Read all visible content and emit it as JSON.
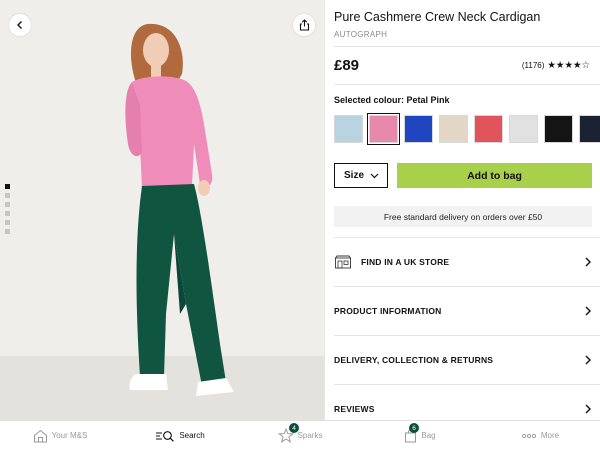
{
  "product": {
    "title": "Pure Cashmere Crew Neck Cardigan",
    "brand": "AUTOGRAPH",
    "price": "£89",
    "review_count": "(1176)",
    "rating": 4,
    "stars_display": "★★★★☆",
    "selected_colour_label": "Selected colour: Petal Pink",
    "swatches": [
      {
        "name": "Light Blue",
        "color": "#b9d3e0"
      },
      {
        "name": "Petal Pink",
        "color": "#e789ad",
        "selected": true
      },
      {
        "name": "Bright Blue",
        "color": "#1f45c0"
      },
      {
        "name": "Oatmeal",
        "color": "#e2d7c4"
      },
      {
        "name": "Coral Red",
        "color": "#e2545c"
      },
      {
        "name": "Light Grey",
        "color": "#e1e1e1"
      },
      {
        "name": "Black",
        "color": "#141414"
      },
      {
        "name": "Navy",
        "color": "#1b2333"
      }
    ],
    "size_label": "Size",
    "add_to_bag_label": "Add to bag",
    "delivery_text": "Free standard delivery on orders over £50",
    "rows": [
      {
        "label": "FIND IN A UK STORE",
        "icon": "store-icon"
      },
      {
        "label": "PRODUCT INFORMATION"
      },
      {
        "label": "DELIVERY, COLLECTION & RETURNS"
      },
      {
        "label": "REVIEWS"
      }
    ]
  },
  "image": {
    "gallery_dots": 6,
    "active_dot": 0
  },
  "nav": {
    "items": [
      {
        "label": "Your M&S",
        "icon": "home-icon"
      },
      {
        "label": "Search",
        "icon": "search-icon",
        "active": true
      },
      {
        "label": "Sparks",
        "icon": "sparks-icon",
        "badge": "4"
      },
      {
        "label": "Bag",
        "icon": "bag-icon",
        "badge": "6"
      },
      {
        "label": "More",
        "icon": "more-icon"
      }
    ]
  },
  "colors": {
    "accent_green": "#a8d04a",
    "badge_green": "#0d4f3c"
  }
}
